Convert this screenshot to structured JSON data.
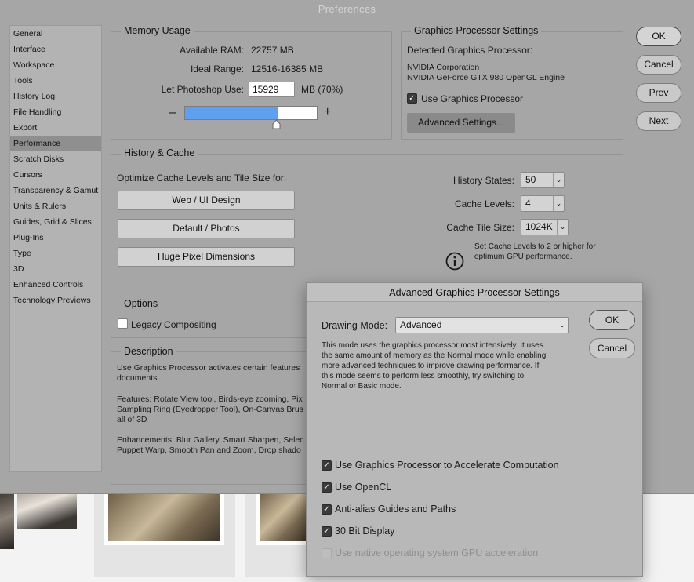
{
  "window": {
    "title": "Preferences"
  },
  "sidebar": {
    "items": [
      {
        "label": "General"
      },
      {
        "label": "Interface"
      },
      {
        "label": "Workspace"
      },
      {
        "label": "Tools"
      },
      {
        "label": "History Log"
      },
      {
        "label": "File Handling"
      },
      {
        "label": "Export"
      },
      {
        "label": "Performance",
        "active": true
      },
      {
        "label": "Scratch Disks"
      },
      {
        "label": "Cursors"
      },
      {
        "label": "Transparency & Gamut"
      },
      {
        "label": "Units & Rulers"
      },
      {
        "label": "Guides, Grid & Slices"
      },
      {
        "label": "Plug-Ins"
      },
      {
        "label": "Type"
      },
      {
        "label": "3D"
      },
      {
        "label": "Enhanced Controls"
      },
      {
        "label": "Technology Previews"
      }
    ]
  },
  "memory": {
    "title": "Memory Usage",
    "available_label": "Available RAM:",
    "available_value": "22757 MB",
    "ideal_label": "Ideal Range:",
    "ideal_value": "12516-16385 MB",
    "let_label": "Let Photoshop Use:",
    "let_value": "15929",
    "let_suffix": "MB (70%)",
    "minus": "–",
    "plus": "+",
    "slider_fraction": 0.7
  },
  "gpu": {
    "title": "Graphics Processor Settings",
    "detected_label": "Detected Graphics Processor:",
    "vendor": "NVIDIA Corporation",
    "model": "NVIDIA GeForce GTX 980 OpenGL Engine",
    "use_label": "Use Graphics Processor",
    "use_checked": true,
    "advanced_button": "Advanced Settings..."
  },
  "buttons": {
    "ok": "OK",
    "cancel": "Cancel",
    "prev": "Prev",
    "next": "Next"
  },
  "history": {
    "title": "History & Cache",
    "optimize_label": "Optimize Cache Levels and Tile Size for:",
    "presets": [
      "Web / UI Design",
      "Default / Photos",
      "Huge Pixel Dimensions"
    ],
    "states_label": "History States:",
    "states_value": "50",
    "levels_label": "Cache Levels:",
    "levels_value": "4",
    "tile_label": "Cache Tile Size:",
    "tile_value": "1024K",
    "info_line1": "Set Cache Levels to 2 or higher for",
    "info_line2": "optimum GPU performance.",
    "info_icon": "info-icon"
  },
  "options": {
    "title": "Options",
    "legacy_label": "Legacy Compositing",
    "legacy_checked": false
  },
  "description": {
    "title": "Description",
    "p1_l1": "Use Graphics Processor activates certain features",
    "p1_l2": "documents.",
    "p2_l1": "Features: Rotate View tool, Birds-eye zooming, Pix",
    "p2_l2": "Sampling Ring (Eyedropper Tool), On-Canvas Brus",
    "p2_l3": "all of 3D",
    "p3_l1": "Enhancements: Blur Gallery, Smart Sharpen, Selec",
    "p3_l2": "Puppet Warp, Smooth Pan and Zoom, Drop shado"
  },
  "advanced": {
    "title": "Advanced Graphics Processor Settings",
    "mode_label": "Drawing Mode:",
    "mode_value": "Advanced",
    "ok": "OK",
    "cancel": "Cancel",
    "desc_l1": "This mode uses the graphics processor most intensively.  It uses",
    "desc_l2": "the same amount of memory as the Normal mode while enabling",
    "desc_l3": "more advanced techniques to improve drawing performance.  If",
    "desc_l4": "this mode seems to perform less smoothly, try switching to",
    "desc_l5": "Normal or Basic mode.",
    "options": [
      {
        "label": "Use Graphics Processor to Accelerate Computation",
        "checked": true,
        "enabled": true
      },
      {
        "label": "Use OpenCL",
        "checked": true,
        "enabled": true
      },
      {
        "label": "Anti-alias Guides and Paths",
        "checked": true,
        "enabled": true
      },
      {
        "label": "30 Bit Display",
        "checked": true,
        "enabled": true
      },
      {
        "label": "Use native operating system GPU acceleration",
        "checked": false,
        "enabled": false
      }
    ]
  }
}
